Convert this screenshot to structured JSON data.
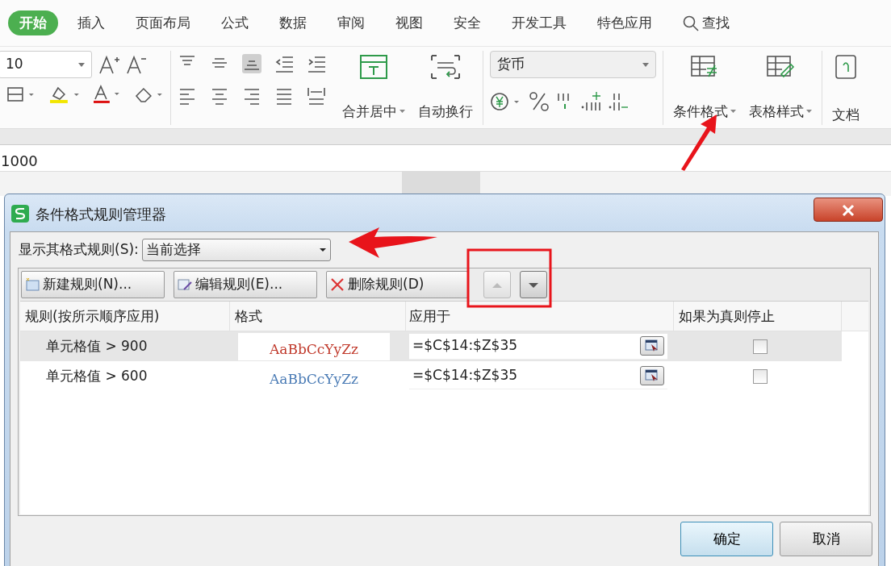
{
  "tabs": [
    {
      "label": "开始",
      "selected": true
    },
    {
      "label": "插入",
      "selected": false
    },
    {
      "label": "页面布局",
      "selected": false
    },
    {
      "label": "公式",
      "selected": false
    },
    {
      "label": "数据",
      "selected": false
    },
    {
      "label": "审阅",
      "selected": false
    },
    {
      "label": "视图",
      "selected": false
    },
    {
      "label": "安全",
      "selected": false
    },
    {
      "label": "开发工具",
      "selected": false
    },
    {
      "label": "特色应用",
      "selected": false
    }
  ],
  "search": {
    "label": "查找"
  },
  "ribbon": {
    "font_size": "10",
    "number_format": "货币",
    "alignment_buttons": [
      "合并居中",
      "自动换行"
    ],
    "style_buttons": [
      "条件格式",
      "表格样式",
      "文档"
    ]
  },
  "formula_bar": {
    "value": "1000"
  },
  "dialog": {
    "title": "条件格式规则管理器",
    "show_rules_label": "显示其格式规则(S):",
    "show_rules_value": "当前选择",
    "toolbar": [
      {
        "label": "新建规则(N)...",
        "kind": "new"
      },
      {
        "label": "编辑规则(E)...",
        "kind": "edit"
      },
      {
        "label": "删除规则(D)",
        "kind": "delete"
      }
    ],
    "move_up": {
      "disabled": true
    },
    "move_down": {
      "disabled": false
    },
    "columns": [
      "规则(按所示顺序应用)",
      "格式",
      "应用于",
      "如果为真则停止"
    ],
    "rules": [
      {
        "rule": "单元格值 > 900",
        "sample": "AaBbCcYyZz",
        "color": "#c0392b",
        "applies_to": "=$C$14:$Z$35",
        "stop_if_true": false,
        "selected": true
      },
      {
        "rule": "单元格值 > 600",
        "sample": "AaBbCcYyZz",
        "color": "#4a7bb5",
        "applies_to": "=$C$14:$Z$35",
        "stop_if_true": false,
        "selected": false
      }
    ],
    "buttons": [
      {
        "label": "确定",
        "default": true
      },
      {
        "label": "取消",
        "default": false
      }
    ]
  }
}
